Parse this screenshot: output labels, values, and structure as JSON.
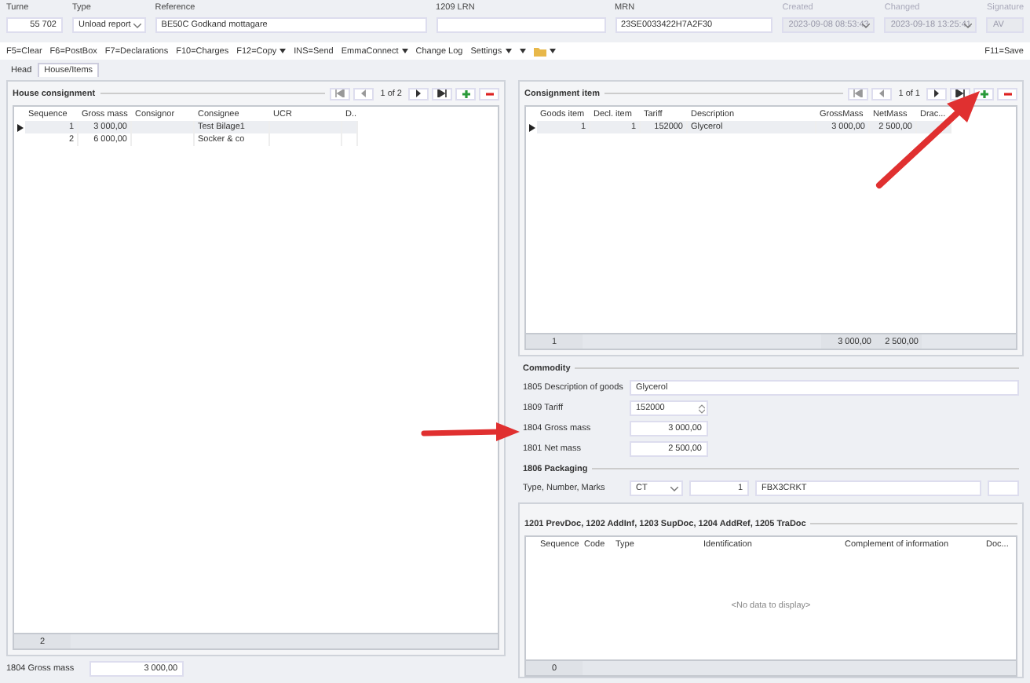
{
  "header_fields": [
    {
      "label": "Turne",
      "value": "55 702",
      "kind": "number",
      "disabled": false
    },
    {
      "label": "Type",
      "value": "Unload report",
      "kind": "dropdown",
      "disabled": false
    },
    {
      "label": "Reference",
      "value": "BE50C Godkand mottagare",
      "kind": "text",
      "disabled": false
    },
    {
      "label": "1209 LRN",
      "kind": "text",
      "disabled": false
    },
    {
      "label": "MRN",
      "value": "23SE0033422H7A2F30",
      "kind": "text",
      "disabled": false
    },
    {
      "label": "Created",
      "value": "2023-09-08 08:53:43",
      "kind": "dropdown",
      "disabled": true
    },
    {
      "label": "Changed",
      "value": "2023-09-18 13:25:41",
      "kind": "dropdown",
      "disabled": true
    },
    {
      "label": "Signature",
      "value": "AV",
      "kind": "text",
      "disabled": true
    }
  ],
  "toolbar": [
    {
      "label": "F5=Clear",
      "kind": "button"
    },
    {
      "label": "F6=PostBox",
      "kind": "button"
    },
    {
      "label": "F7=Declarations",
      "kind": "button"
    },
    {
      "label": "F10=Charges",
      "kind": "button"
    },
    {
      "label": "F12=Copy",
      "kind": "menu"
    },
    {
      "label": "INS=Send",
      "kind": "button"
    },
    {
      "label": "EmmaConnect",
      "kind": "menu"
    },
    {
      "label": "Change Log",
      "kind": "button"
    },
    {
      "label": "Settings",
      "kind": "menu"
    },
    {
      "kind": "menu"
    },
    {
      "kind": "folder"
    }
  ],
  "save_button": "F11=Save",
  "tabs": [
    {
      "label": "Head",
      "selected": false
    },
    {
      "label": "House/Items",
      "selected": true
    }
  ],
  "house_consignment": {
    "title": "House consignment",
    "pager": "1 of 2",
    "columns": [
      "Sequence",
      "Gross mass",
      "Consignor",
      "Consignee",
      "UCR",
      "D.."
    ],
    "rows": [
      {
        "cells": [
          "1",
          "3 000,00",
          "",
          "Test Bilage1",
          "",
          ""
        ],
        "selected": true
      },
      {
        "cells": [
          "2",
          "6 000,00",
          "",
          "Socker & co",
          "",
          ""
        ],
        "selected": false
      }
    ],
    "footer": "2"
  },
  "gross_mass_total": {
    "label": "1804 Gross mass",
    "value": "3 000,00"
  },
  "consignment_item": {
    "title": "Consignment item",
    "pager": "1 of 1",
    "columns": [
      "Goods item",
      "Decl. item",
      "Tariff",
      "Description",
      "GrossMass",
      "NetMass",
      "Drac..."
    ],
    "rows": [
      {
        "cells": [
          "1",
          "1",
          "152000",
          "Glycerol",
          "3 000,00",
          "2 500,00",
          ""
        ],
        "selected": true
      }
    ],
    "footer": [
      "1",
      "3 000,00",
      "2 500,00"
    ]
  },
  "commodity": {
    "title": "Commodity",
    "fields": [
      {
        "label": "1805 Description of goods",
        "value": "Glycerol",
        "kind": "wide"
      },
      {
        "label": "1809 Tariff",
        "value": "152000",
        "kind": "spinner"
      },
      {
        "label": "1804 Gross mass",
        "value": "3 000,00",
        "kind": "number"
      },
      {
        "label": "1801 Net mass",
        "value": "2 500,00",
        "kind": "number"
      }
    ]
  },
  "packaging": {
    "title": "1806 Packaging",
    "label": "Type, Number, Marks",
    "type": "CT",
    "number": "1",
    "marks": "FBX3CRKT"
  },
  "documents": {
    "title": "1201 PrevDoc, 1202 AddInf,  1203 SupDoc, 1204 AddRef, 1205 TraDoc",
    "columns": [
      "Sequence",
      "Code",
      "Type",
      "Identification",
      "Complement of information",
      "Doc..."
    ],
    "empty_text": "<No data to display>",
    "footer": "0"
  }
}
